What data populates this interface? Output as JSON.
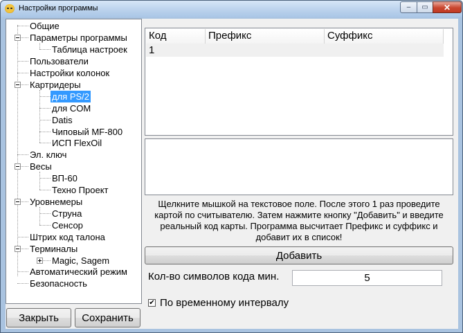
{
  "window": {
    "title": "Настройки программы"
  },
  "title_buttons": {
    "minimize": "–",
    "maximize": "▭",
    "close": "✕"
  },
  "tree": {
    "items": [
      "Общие",
      "Параметры программы",
      "Таблица настроек",
      "Пользователи",
      "Настройки колонок",
      "Картридеры",
      "для PS/2",
      "для COM",
      "Datis",
      "Чиповый MF-800",
      "ИСП FlexOil",
      "Эл. ключ",
      "Весы",
      "ВП-60",
      "Техно Проект",
      "Уровнемеры",
      "Струна",
      "Сенсор",
      "Штрих код талона",
      "Терминалы",
      "Magic, Sagem",
      "Автоматический режим",
      "Безопасность"
    ],
    "selected": "для PS/2"
  },
  "buttons": {
    "close": "Закрыть",
    "save": "Сохранить",
    "add": "Добавить"
  },
  "grid": {
    "columns": [
      "Код",
      "Префикс",
      "Суффикс"
    ],
    "rows": [
      [
        "1",
        "",
        ""
      ]
    ]
  },
  "instruction": "Щелкните мышкой на текстовое поле. После этого 1 раз проведите картой по считывателю. Затем нажмите кнопку \"Добавить\" и введите реальный код карты. Программа высчитает Префикс и суффикс и добавит их в список!",
  "min_code_length": {
    "label": "Кол-во символов кода мин.",
    "value": "5"
  },
  "time_interval": {
    "label": "По временному интервалу",
    "checked": true,
    "mark": "✔"
  }
}
